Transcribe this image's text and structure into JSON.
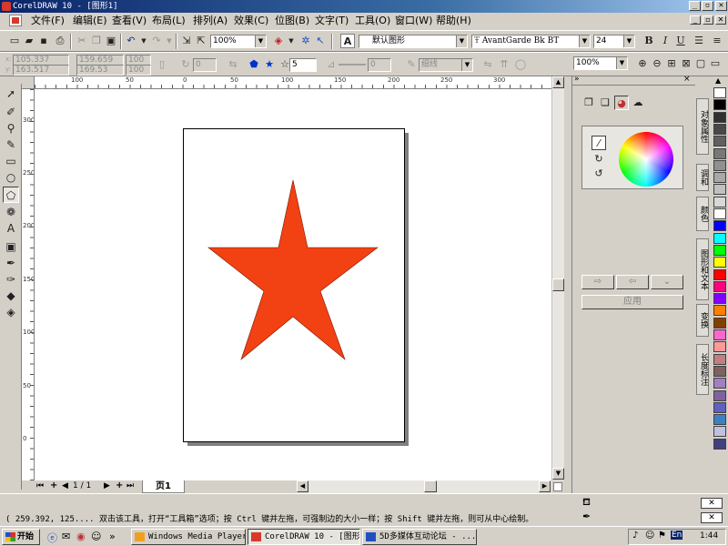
{
  "window": {
    "title": "CorelDRAW 10 - [图形1]",
    "min": "_",
    "max": "▫",
    "close": "✕"
  },
  "menu": {
    "items": [
      "文件(F)",
      "编辑(E)",
      "查看(V)",
      "布局(L)",
      "排列(A)",
      "效果(C)",
      "位图(B)",
      "文字(T)",
      "工具(O)",
      "窗口(W)",
      "帮助(H)"
    ]
  },
  "toolbar": {
    "zoom": "100%",
    "style": "默认图形",
    "font": "AvantGarde Bk BT",
    "size": "24",
    "bold": "B",
    "italic": "I",
    "underline": "U"
  },
  "propbar": {
    "x": "105.337",
    "y": "163.517",
    "w": "159.659",
    "h": "169.53",
    "sx": "100",
    "sy": "100",
    "rot": "0",
    "points": "5",
    "sharp": "0",
    "outline": "细线",
    "zoom2": "100%"
  },
  "ruler": {
    "h": [
      "100",
      "50",
      "0",
      "50",
      "100",
      "150",
      "200",
      "250",
      "300"
    ],
    "v": [
      "300",
      "250",
      "200",
      "150",
      "100",
      "50",
      "0"
    ]
  },
  "pagebar": {
    "page": "1 / 1",
    "tab": "页1"
  },
  "docker": {
    "apply": "应用"
  },
  "docker_tabs": [
    "对象属性",
    "调和",
    "颜色",
    "图形和文本",
    "变换",
    "长度标注"
  ],
  "colors": {
    "star": "#f24113",
    "accent": "#0a246a",
    "palette": [
      "#ffffff",
      "#000000",
      "#303030",
      "#484848",
      "#606060",
      "#787878",
      "#909090",
      "#a8a8a8",
      "#c0c0c0",
      "#d8d8d8",
      "#ffffff",
      "#0000ff",
      "#00ffff",
      "#00ff00",
      "#ffff00",
      "#ff0000",
      "#ff0080",
      "#8000ff",
      "#ff8000",
      "#804000",
      "#ff66cc",
      "#ff9999",
      "#c08080",
      "#806060",
      "#a080c0",
      "#8060a0",
      "#6060c0",
      "#4080c0",
      "#c0c0e0",
      "#404080"
    ]
  },
  "status": {
    "text": "( 259.392, 125.... 双击该工具，打开“工具箱”选项；按 Ctrl 键并左拖，可强制边的大小一样；按 Shift 键并左拖，则可从中心绘制。"
  },
  "taskbar": {
    "start": "开始",
    "tasks": [
      "Windows Media Player",
      "CorelDRAW 10 - [图形1]",
      "5D多媒体互动论坛 - ..."
    ],
    "clock": "1:44"
  }
}
